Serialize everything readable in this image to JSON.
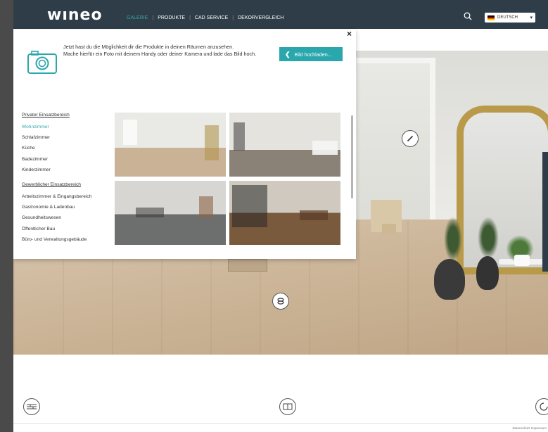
{
  "header": {
    "logo": "wıneo",
    "nav": [
      {
        "label": "GALERIE",
        "active": true
      },
      {
        "label": "PRODUKTE",
        "active": false
      },
      {
        "label": "CAD SERVICE",
        "active": false
      },
      {
        "label": "DEKORVERGLEICH",
        "active": false
      }
    ],
    "language": "DEUTSCH"
  },
  "popup": {
    "info_line1": "Jetzt hast du die Möglichkeit dir die Produkte in deinen Räumen anzusehen.",
    "info_line2": "Mache hierfür ein Foto mit deinem Handy oder deiner Kamera und lade das Bild hoch.",
    "upload_label": "Bild hochladen...",
    "close": "×",
    "categories": {
      "private_head": "Privater Einsatzbereich",
      "private": [
        "Wohnzimmer",
        "Schlafzimmer",
        "Küche",
        "Badezimmer",
        "Kinderzimmer"
      ],
      "commercial_head": "Gewerblicher Einsatzbereich",
      "commercial": [
        "Arbeitszimmer & Eingangsbereich",
        "Gastronomie & Ladenbau",
        "Gesundheitswesen",
        "Öffentlicher Bau",
        "Büro- und Verwaltungsgebäude"
      ]
    }
  },
  "footer": {
    "links": "Datenschutz   Impressum"
  },
  "colors": {
    "accent": "#2aa7ac",
    "header_bg": "#2e3d47"
  }
}
